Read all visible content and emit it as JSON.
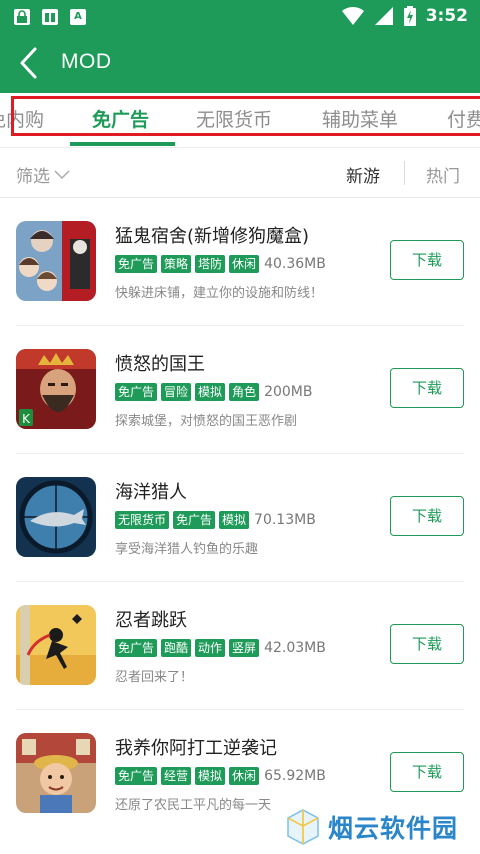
{
  "status_bar": {
    "time": "3:52",
    "left_icons": [
      "lock-icon",
      "book-icon",
      "app-a-icon"
    ],
    "right_icons": [
      "wifi-icon",
      "signal-icon",
      "battery-charging-icon"
    ]
  },
  "app_bar": {
    "title": "MOD",
    "back_icon": "back-arrow-icon"
  },
  "tabs": [
    {
      "label": "免内购",
      "active": false
    },
    {
      "label": "免广告",
      "active": true
    },
    {
      "label": "无限货币",
      "active": false
    },
    {
      "label": "辅助菜单",
      "active": false
    },
    {
      "label": "付费",
      "active": false
    }
  ],
  "filter": {
    "label": "筛选",
    "sort_new": "新游",
    "sort_hot": "热门"
  },
  "games": [
    {
      "name": "猛鬼宿舍(新增修狗魔盒)",
      "tags": [
        "免广告",
        "策略",
        "塔防",
        "休闲"
      ],
      "size": "40.36MB",
      "desc": "快躲进床铺，建立你的设施和防线！",
      "button": "下载"
    },
    {
      "name": "愤怒的国王",
      "tags": [
        "免广告",
        "冒险",
        "模拟",
        "角色"
      ],
      "size": "200MB",
      "desc": "探索城堡，对愤怒的国王恶作剧",
      "button": "下载"
    },
    {
      "name": "海洋猎人",
      "tags": [
        "无限货币",
        "免广告",
        "模拟"
      ],
      "size": "70.13MB",
      "desc": "享受海洋猎人钓鱼的乐趣",
      "button": "下载"
    },
    {
      "name": "忍者跳跃",
      "tags": [
        "免广告",
        "跑酷",
        "动作",
        "竖屏"
      ],
      "size": "42.03MB",
      "desc": "忍者回来了！",
      "button": "下载"
    },
    {
      "name": "我养你阿打工逆袭记",
      "tags": [
        "免广告",
        "经营",
        "模拟",
        "休闲"
      ],
      "size": "65.92MB",
      "desc": "还原了农民工平凡的每一天",
      "button": "下载"
    }
  ],
  "watermark": {
    "text": "烟云软件园"
  },
  "colors": {
    "brand": "#1e9b58",
    "highlight_frame": "#e01b24",
    "watermark": "#2a86c9"
  }
}
